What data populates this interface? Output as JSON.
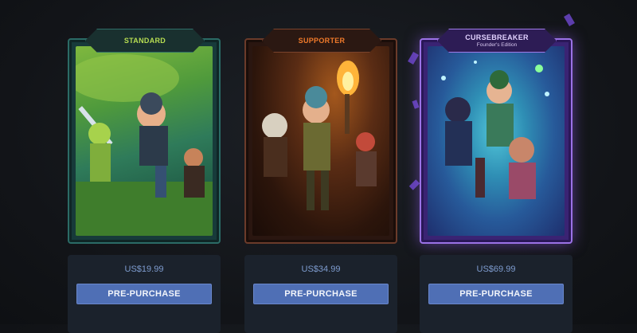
{
  "editions": [
    {
      "name": "STANDARD",
      "subtitle": "",
      "price": "US$19.99",
      "button": "PRE-PURCHASE",
      "accent": "#b7dd52"
    },
    {
      "name": "SUPPORTER",
      "subtitle": "",
      "price": "US$34.99",
      "button": "PRE-PURCHASE",
      "accent": "#f07a2a"
    },
    {
      "name": "CURSEBREAKER",
      "subtitle": "Founder's Edition",
      "price": "US$69.99",
      "button": "PRE-PURCHASE",
      "accent": "#e2d2ff"
    }
  ]
}
